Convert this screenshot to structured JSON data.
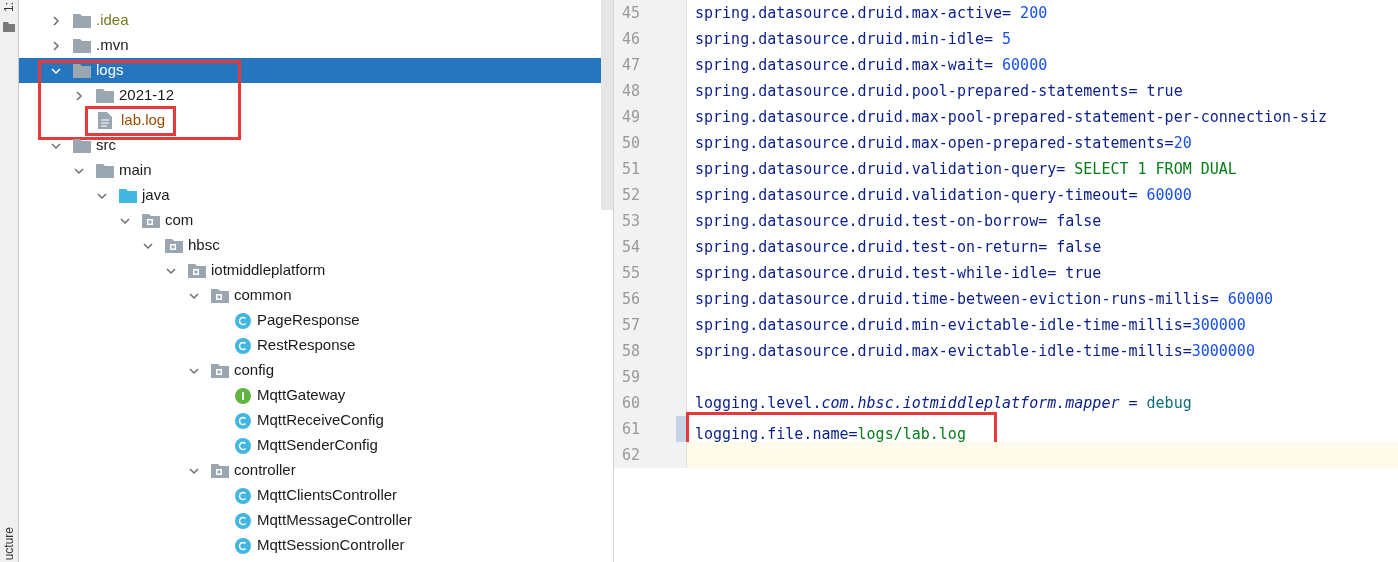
{
  "side_strip": {
    "top_label": "1:",
    "bottom_label": "ucture"
  },
  "project_tree": [
    {
      "label": ".idea",
      "kind": "folder",
      "expanded": false,
      "selected": false,
      "color": "#787823"
    },
    {
      "label": ".mvn",
      "kind": "folder",
      "expanded": false,
      "selected": false
    },
    {
      "label": "logs",
      "kind": "folder",
      "expanded": true,
      "selected": true,
      "annotated": true,
      "children": [
        {
          "label": "2021-12",
          "kind": "folder",
          "expanded": false,
          "selected": false
        },
        {
          "label": "lab.log",
          "kind": "file",
          "selected": false,
          "annotated": true,
          "color": "#a04a00"
        }
      ]
    },
    {
      "label": "src",
      "kind": "folder",
      "expanded": true,
      "selected": false,
      "children": [
        {
          "label": "main",
          "kind": "folder",
          "expanded": true,
          "selected": false,
          "children": [
            {
              "label": "java",
              "kind": "source-folder",
              "expanded": true,
              "selected": false,
              "children": [
                {
                  "label": "com",
                  "kind": "package",
                  "expanded": true,
                  "selected": false,
                  "children": [
                    {
                      "label": "hbsc",
                      "kind": "package",
                      "expanded": true,
                      "selected": false,
                      "children": [
                        {
                          "label": "iotmiddleplatform",
                          "kind": "package",
                          "expanded": true,
                          "selected": false,
                          "children": [
                            {
                              "label": "common",
                              "kind": "package",
                              "expanded": true,
                              "selected": false,
                              "children": [
                                {
                                  "label": "PageResponse",
                                  "kind": "class",
                                  "selected": false
                                },
                                {
                                  "label": "RestResponse",
                                  "kind": "class",
                                  "selected": false
                                }
                              ]
                            },
                            {
                              "label": "config",
                              "kind": "package",
                              "expanded": true,
                              "selected": false,
                              "children": [
                                {
                                  "label": "MqttGateway",
                                  "kind": "interface",
                                  "selected": false
                                },
                                {
                                  "label": "MqttReceiveConfig",
                                  "kind": "class",
                                  "selected": false
                                },
                                {
                                  "label": "MqttSenderConfig",
                                  "kind": "class",
                                  "selected": false
                                }
                              ]
                            },
                            {
                              "label": "controller",
                              "kind": "package",
                              "expanded": true,
                              "selected": false,
                              "children": [
                                {
                                  "label": "MqttClientsController",
                                  "kind": "class",
                                  "selected": false
                                },
                                {
                                  "label": "MqttMessageController",
                                  "kind": "class",
                                  "selected": false
                                },
                                {
                                  "label": "MqttSessionController",
                                  "kind": "class",
                                  "selected": false
                                }
                              ]
                            }
                          ]
                        }
                      ]
                    }
                  ]
                }
              ]
            }
          ]
        }
      ]
    }
  ],
  "editor": {
    "lines": [
      {
        "number": "45",
        "segments": [
          {
            "kind": "key",
            "text": "spring.datasource.druid.max-active="
          },
          {
            "kind": "number",
            "text": " 200"
          }
        ]
      },
      {
        "number": "46",
        "segments": [
          {
            "kind": "key",
            "text": "spring.datasource.druid.min-idle="
          },
          {
            "kind": "number",
            "text": " 5"
          }
        ]
      },
      {
        "number": "47",
        "segments": [
          {
            "kind": "key",
            "text": "spring.datasource.druid.max-wait="
          },
          {
            "kind": "number",
            "text": " 60000"
          }
        ]
      },
      {
        "number": "48",
        "segments": [
          {
            "kind": "key",
            "text": "spring.datasource.druid.pool-prepared-statements="
          },
          {
            "kind": "keyword",
            "text": " true"
          }
        ]
      },
      {
        "number": "49",
        "segments": [
          {
            "kind": "key",
            "text": "spring.datasource.druid.max-pool-prepared-statement-per-connection-siz"
          }
        ]
      },
      {
        "number": "50",
        "segments": [
          {
            "kind": "key",
            "text": "spring.datasource.druid.max-open-prepared-statements="
          },
          {
            "kind": "number",
            "text": "20"
          }
        ]
      },
      {
        "number": "51",
        "segments": [
          {
            "kind": "key",
            "text": "spring.datasource.druid.validation-query="
          },
          {
            "kind": "string",
            "text": " SELECT 1 FROM DUAL"
          }
        ]
      },
      {
        "number": "52",
        "segments": [
          {
            "kind": "key",
            "text": "spring.datasource.druid.validation-query-timeout="
          },
          {
            "kind": "number",
            "text": " 60000"
          }
        ]
      },
      {
        "number": "53",
        "segments": [
          {
            "kind": "key",
            "text": "spring.datasource.druid.test-on-borrow="
          },
          {
            "kind": "keyword",
            "text": " false"
          }
        ]
      },
      {
        "number": "54",
        "segments": [
          {
            "kind": "key",
            "text": "spring.datasource.druid.test-on-return="
          },
          {
            "kind": "keyword",
            "text": " false"
          }
        ]
      },
      {
        "number": "55",
        "segments": [
          {
            "kind": "key",
            "text": "spring.datasource.druid.test-while-idle="
          },
          {
            "kind": "keyword",
            "text": " true"
          }
        ]
      },
      {
        "number": "56",
        "segments": [
          {
            "kind": "key",
            "text": "spring.datasource.druid.time-between-eviction-runs-millis="
          },
          {
            "kind": "number",
            "text": " 60000"
          }
        ]
      },
      {
        "number": "57",
        "segments": [
          {
            "kind": "key",
            "text": "spring.datasource.druid.min-evictable-idle-time-millis="
          },
          {
            "kind": "number",
            "text": "300000"
          }
        ]
      },
      {
        "number": "58",
        "segments": [
          {
            "kind": "key",
            "text": "spring.datasource.druid.max-evictable-idle-time-millis="
          },
          {
            "kind": "number",
            "text": "3000000"
          }
        ]
      },
      {
        "number": "59"
      },
      {
        "number": "60",
        "segments": [
          {
            "kind": "key",
            "text": "logging.level."
          },
          {
            "kind": "italic",
            "text": "com.hbsc.iotmiddleplatform.mapper"
          },
          {
            "kind": "key",
            "text": " = "
          },
          {
            "kind": "value",
            "text": "debug"
          }
        ]
      },
      {
        "number": "61",
        "annotated": true,
        "segments": [
          {
            "kind": "key",
            "text": "logging.file.name="
          },
          {
            "kind": "string",
            "text": "logs/lab.log"
          }
        ]
      },
      {
        "number": "62",
        "current": true
      }
    ]
  }
}
